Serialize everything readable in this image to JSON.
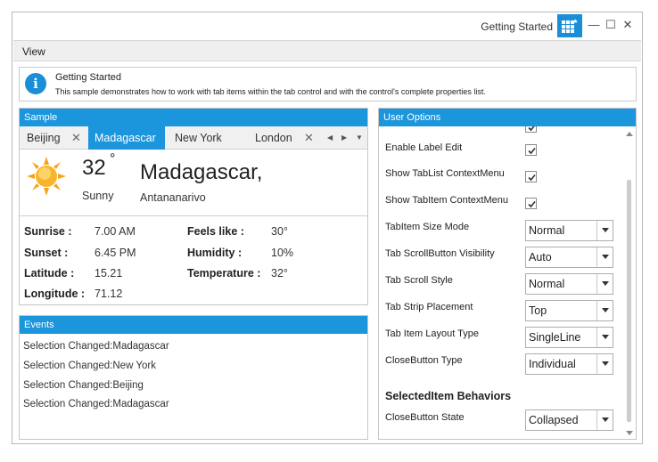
{
  "window": {
    "title": "Getting Started",
    "app_icon": "grid-icon",
    "controls": {
      "minimize": "—",
      "maximize": "☐",
      "close": "✕"
    }
  },
  "menu": {
    "view": "View"
  },
  "info": {
    "icon": "info-icon",
    "title": "Getting Started",
    "description": "This sample demonstrates how to work with tab items within the tab control and with the control's complete properties list."
  },
  "sample": {
    "header": "Sample",
    "tabs": [
      {
        "label": "Beijing",
        "closable": true,
        "selected": false
      },
      {
        "label": "Madagascar",
        "closable": false,
        "selected": true
      },
      {
        "label": "New York",
        "closable": false,
        "selected": false
      },
      {
        "label": "London",
        "closable": true,
        "selected": false
      }
    ],
    "weather": {
      "icon": "sun-icon",
      "temperature": "32",
      "degree_symbol": "°",
      "condition": "Sunny",
      "city": "Madagascar,",
      "region": "Antananarivo",
      "details": [
        {
          "label": "Sunrise :",
          "value": "7.00 AM"
        },
        {
          "label": "Sunset :",
          "value": "6.45 PM"
        },
        {
          "label": "Latitude :",
          "value": "15.21"
        },
        {
          "label": "Longitude :",
          "value": "71.12"
        },
        {
          "label": "Feels like :",
          "value": "30°"
        },
        {
          "label": "Humidity :",
          "value": "10%"
        },
        {
          "label": "Temperature :",
          "value": "32°"
        }
      ]
    }
  },
  "events": {
    "header": "Events",
    "items": [
      "Selection Changed:Madagascar",
      "Selection Changed:New York",
      "Selection Changed:Beijing",
      "Selection Changed:Madagascar"
    ]
  },
  "options": {
    "header": "User Options",
    "checkboxes": [
      {
        "label": "Enable Label Edit",
        "checked": true
      },
      {
        "label": "Show TabList ContextMenu",
        "checked": true
      },
      {
        "label": "Show TabItem ContextMenu",
        "checked": true
      }
    ],
    "combos": [
      {
        "label": "TabItem Size Mode",
        "value": "Normal"
      },
      {
        "label": "Tab ScrollButton Visibility",
        "value": "Auto"
      },
      {
        "label": "Tab Scroll Style",
        "value": "Normal"
      },
      {
        "label": "Tab Strip Placement",
        "value": "Top"
      },
      {
        "label": "Tab Item Layout Type",
        "value": "SingleLine"
      },
      {
        "label": "CloseButton Type",
        "value": "Individual"
      }
    ],
    "section": "SelectedItem Behaviors",
    "close_state": {
      "label": "CloseButton State",
      "value": "Collapsed"
    }
  },
  "colors": {
    "accent": "#1b95dc",
    "sun": "#f7a21b"
  }
}
